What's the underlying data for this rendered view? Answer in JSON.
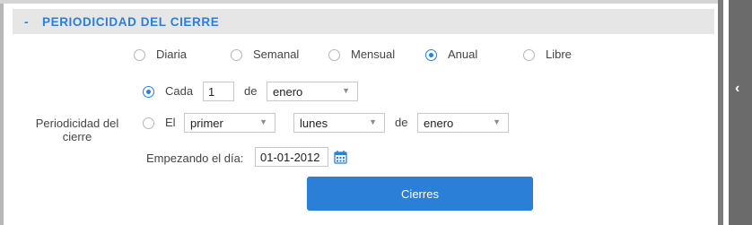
{
  "section": {
    "toggle": "-",
    "title": "PERIODICIDAD DEL CIERRE"
  },
  "frequency_options": [
    {
      "label": "Diaria",
      "checked": false
    },
    {
      "label": "Semanal",
      "checked": false
    },
    {
      "label": "Mensual",
      "checked": false
    },
    {
      "label": "Anual",
      "checked": true
    },
    {
      "label": "Libre",
      "checked": false
    }
  ],
  "periodicidad_label": "Periodicidad del cierre",
  "cada_row": {
    "label": "Cada",
    "value": "1",
    "de_label": "de",
    "month_value": "enero",
    "checked": true
  },
  "el_row": {
    "label": "El",
    "ordinal_value": "primer",
    "weekday_value": "lunes",
    "de_label": "de",
    "month_value": "enero",
    "checked": false
  },
  "start": {
    "label": "Empezando el día:",
    "value": "01-01-2012"
  },
  "button": {
    "label": "Cierres"
  },
  "side_tab": {
    "chevron": "‹"
  },
  "colors": {
    "accent": "#2b7fd6",
    "header_bg": "#e6e6e6",
    "side_tab": "#6b6b6b"
  }
}
